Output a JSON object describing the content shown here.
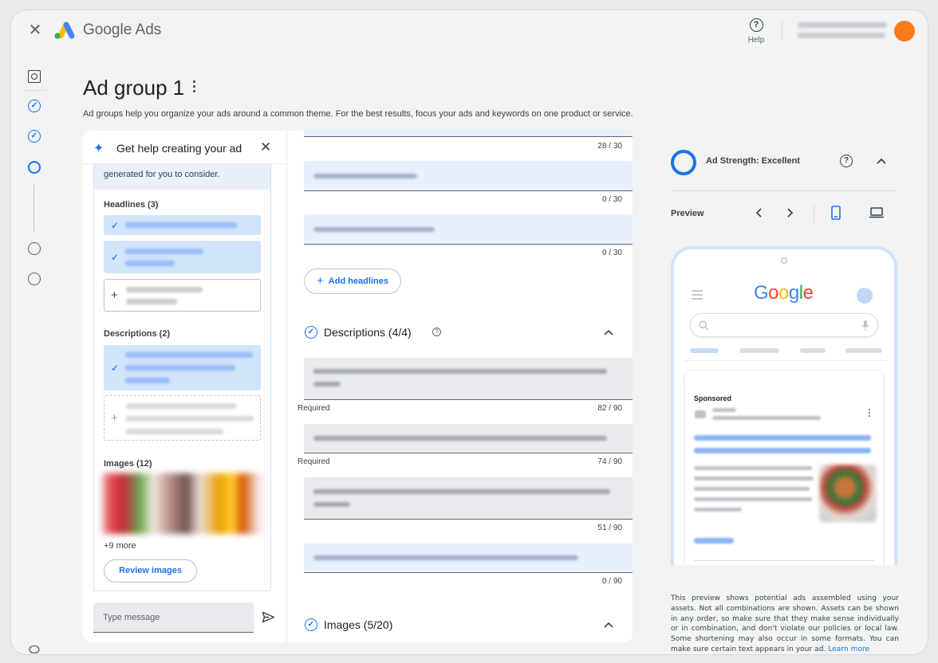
{
  "app": {
    "brand_google": "Google",
    "brand_ads": "Ads",
    "help_label": "Help"
  },
  "page": {
    "title": "Ad group 1",
    "subtitle": "Ad groups help you organize your ads around a common theme. For the best results, focus your ads and keywords on one product or service."
  },
  "assistant": {
    "title": "Get help creating your ad",
    "intro": "generated for you to consider.",
    "headlines_label": "Headlines (3)",
    "descriptions_label": "Descriptions (2)",
    "images_label": "Images (12)",
    "more_label": "+9 more",
    "review_button": "Review images",
    "message_placeholder": "Type message"
  },
  "editor": {
    "headline_counters": [
      "28 / 30",
      "0 / 30",
      "0 / 30"
    ],
    "add_headlines_label": "Add headlines",
    "descriptions_title": "Descriptions (4/4)",
    "description_fields": [
      {
        "required": "Required",
        "counter": "82 / 90"
      },
      {
        "required": "Required",
        "counter": "74 / 90"
      },
      {
        "required": "",
        "counter": "51 / 90"
      },
      {
        "required": "",
        "counter": "0 / 90"
      }
    ],
    "images_title": "Images (5/20)"
  },
  "preview": {
    "strength_label": "Ad Strength: Excellent",
    "preview_label": "Preview",
    "google_logo": "Google",
    "sponsored_label": "Sponsored",
    "disclaimer": "This preview shows potential ads assembled using your assets. Not all combinations are shown. Assets can be shown in any order, so make sure that they make sense individually or in combination, and don't violate our policies or local law. Some shortening may also occur in some formats. You can make sure certain text appears in your ad.",
    "learn_more": "Learn more"
  },
  "colors": {
    "accent": "#1a73e8",
    "avatar": "#fa7b17",
    "chip_selected": "#d2e3fc"
  }
}
